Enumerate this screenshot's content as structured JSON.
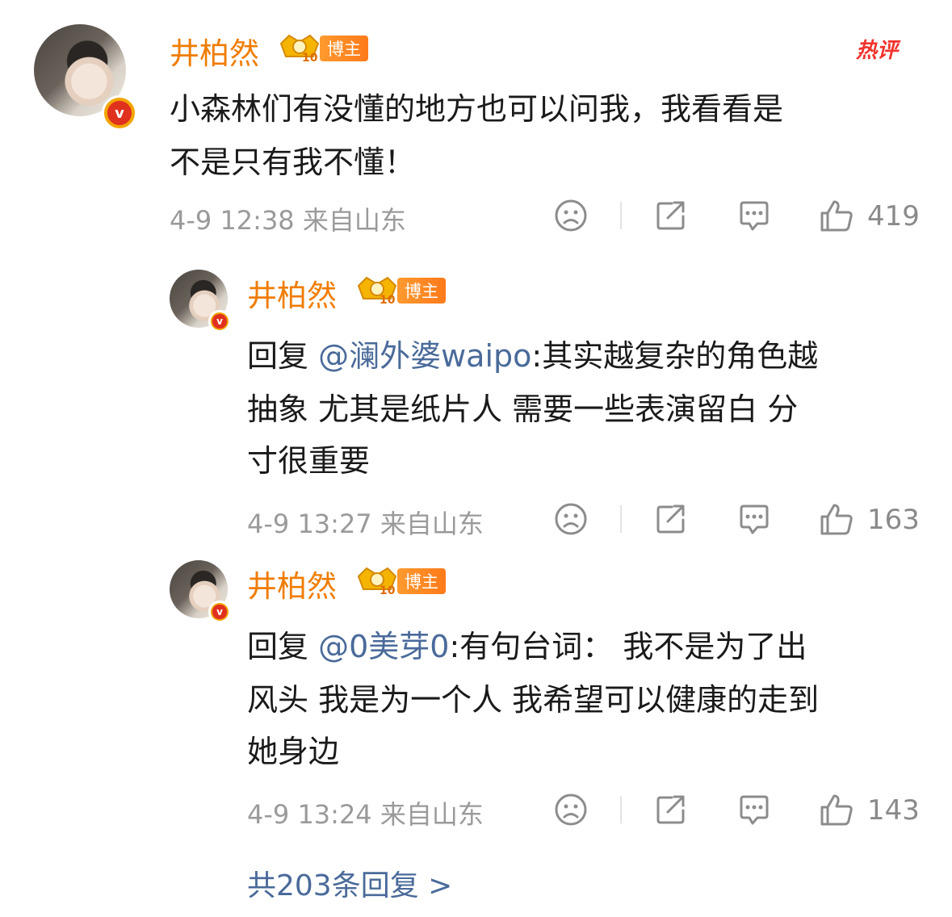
{
  "comments": [
    {
      "author": "井柏然",
      "badge": "博主",
      "hot_label": "热评",
      "line1": "小森林们有没懂的地方也可以问我，我看看是",
      "line2": "不是只有我不懂！",
      "time": "4-9 12:38",
      "location": "来自山东",
      "likes": "419"
    },
    {
      "author": "井柏然",
      "badge": "博主",
      "reply_prefix": "回复 ",
      "mention": "@澜外婆waipo",
      "line1_rest": ":其实越复杂的角色越",
      "line2": "抽象 尤其是纸片人 需要一些表演留白 分",
      "line3": "寸很重要",
      "time": "4-9 13:27",
      "location": "来自山东",
      "likes": "163"
    },
    {
      "author": "井柏然",
      "badge": "博主",
      "reply_prefix": "回复 ",
      "mention": "@0美芽0",
      "line1_rest": ":有句台词： 我不是为了出",
      "line2": "风头 我是为一个人 我希望可以健康的走到",
      "line3": "她身边",
      "time": "4-9 13:24",
      "location": "来自山东",
      "likes": "143"
    }
  ],
  "more_replies": "共203条回复 >",
  "colors": {
    "name": "#f07c00",
    "mention": "#4a6a9a",
    "hot": "#f2322c",
    "meta": "#9a9a9a"
  },
  "icons": [
    "verified-v-icon",
    "crown-level-icon",
    "dislike-face-icon",
    "share-icon",
    "comment-icon",
    "like-thumb-icon"
  ]
}
